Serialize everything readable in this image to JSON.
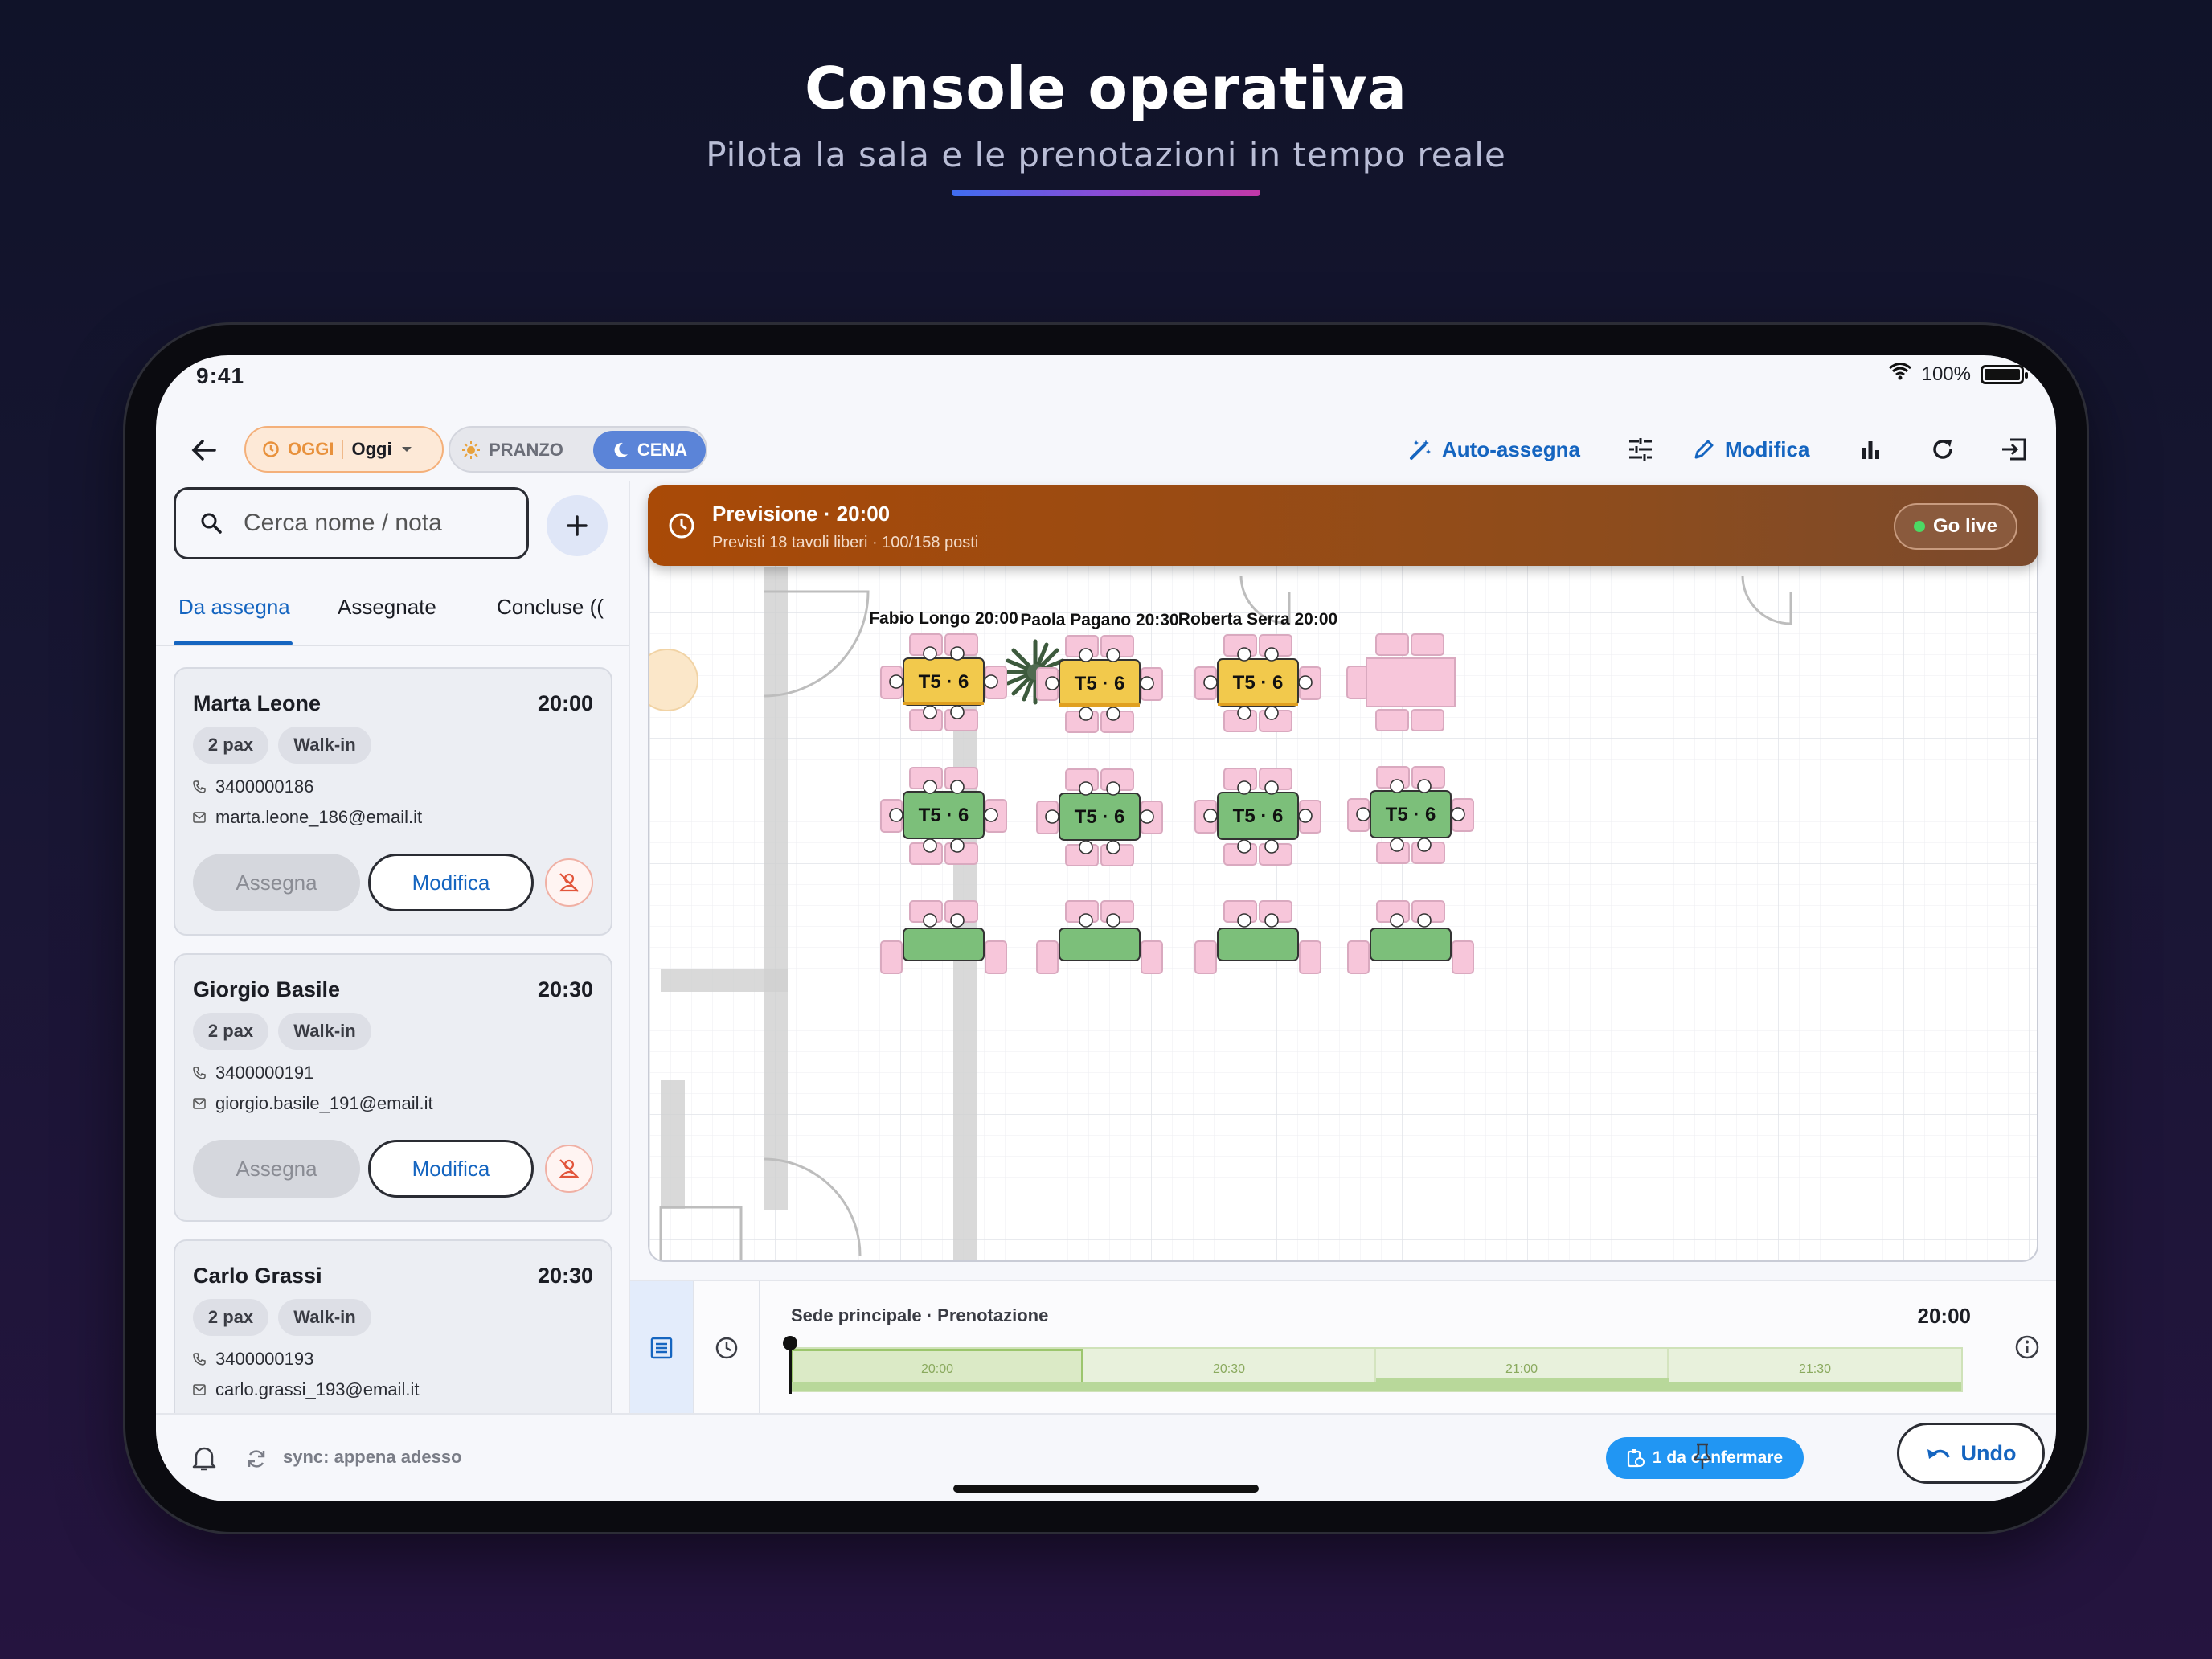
{
  "hero": {
    "title": "Console operativa",
    "subtitle": "Pilota la sala e le prenotazioni in tempo reale"
  },
  "status_bar": {
    "time": "9:41",
    "battery": "100%"
  },
  "appbar": {
    "date_chip_label": "OGGI",
    "date_chip_value": "Oggi",
    "service_lunch": "PRANZO",
    "service_dinner": "CENA",
    "selected_service": "CENA",
    "auto_assign": "Auto-assegna",
    "edit": "Modifica"
  },
  "sidebar": {
    "search_placeholder": "Cerca nome / nota",
    "tabs": [
      {
        "label": "Da assegna"
      },
      {
        "label": "Assegnate"
      },
      {
        "label": "Concluse (("
      }
    ],
    "assign_label": "Assegna",
    "edit_label": "Modifica",
    "reservations": [
      {
        "name": "Marta Leone",
        "time": "20:00",
        "pax": "2 pax",
        "source": "Walk-in",
        "phone": "3400000186",
        "email": "marta.leone_186@email.it"
      },
      {
        "name": "Giorgio Basile",
        "time": "20:30",
        "pax": "2 pax",
        "source": "Walk-in",
        "phone": "3400000191",
        "email": "giorgio.basile_191@email.it"
      },
      {
        "name": "Carlo Grassi",
        "time": "20:30",
        "pax": "2 pax",
        "source": "Walk-in",
        "phone": "3400000193",
        "email": "carlo.grassi_193@email.it"
      }
    ]
  },
  "forecast": {
    "title": "Previsione · 20:00",
    "subtitle": "Previsti 18 tavoli liberi · 100/158 posti",
    "go_live": "Go live"
  },
  "floor": {
    "colors": {
      "reserved": "#f2c94c",
      "free": "#7cbf7a",
      "chair": "#f7c6da"
    },
    "tables": [
      {
        "label": "T5 · 6",
        "status": "reserved",
        "guest": "Fabio Longo 20:00"
      },
      {
        "label": "T5 · 6",
        "status": "reserved",
        "guest": "Paola Pagano 20:30"
      },
      {
        "label": "T5 · 6",
        "status": "reserved",
        "guest": "Roberta Serra 20:00"
      },
      {
        "label": "T5 · 6",
        "status": "free",
        "guest": ""
      },
      {
        "label": "T5 · 6",
        "status": "free",
        "guest": ""
      },
      {
        "label": "T5 · 6",
        "status": "free",
        "guest": ""
      },
      {
        "label": "T5 · 6",
        "status": "free",
        "guest": ""
      }
    ]
  },
  "timeline": {
    "title": "Sede principale · Prenotazione",
    "current_time": "20:00",
    "slots": [
      "20:00",
      "20:30",
      "21:00",
      "21:30"
    ]
  },
  "bottom": {
    "sync": "sync: appena adesso",
    "pending": "1 da confermare",
    "undo": "Undo"
  }
}
